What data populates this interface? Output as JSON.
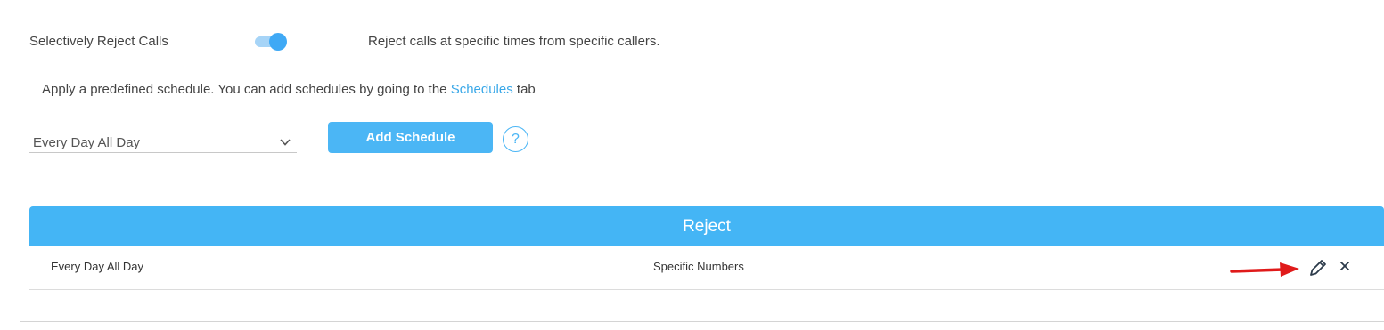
{
  "toggle_row": {
    "label": "Selectively Reject Calls",
    "enabled": true,
    "description": "Reject calls at specific times from specific callers."
  },
  "schedule_info": {
    "text_before": "Apply a predefined schedule. You can add schedules by going to the ",
    "link": "Schedules",
    "text_after": " tab"
  },
  "schedule_select": {
    "value": "Every Day All Day",
    "icon": "chevron-down-icon"
  },
  "add_schedule_button": "Add Schedule",
  "help_button": "?",
  "table": {
    "header": "Reject",
    "rows": [
      {
        "schedule": "Every Day All Day",
        "type": "Specific Numbers"
      }
    ]
  },
  "colors": {
    "accent": "#44b5f5",
    "link": "#3aa8e8",
    "annotation_arrow": "#e01a1a"
  }
}
